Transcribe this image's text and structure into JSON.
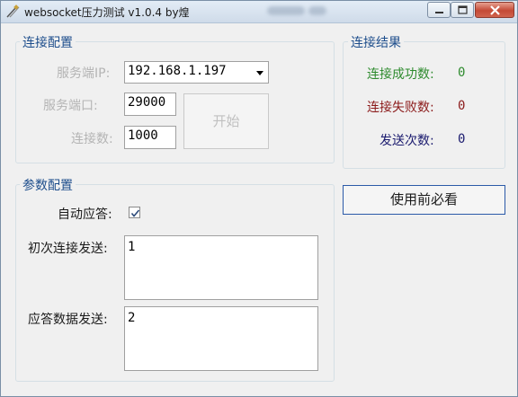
{
  "window": {
    "title": "websocket压力测试 v1.0.4 by煌"
  },
  "connection_config": {
    "title": "连接配置",
    "server_ip_label": "服务端IP:",
    "server_ip_value": "192.168.1.197",
    "server_port_label": "服务端口:",
    "server_port_value": "29000",
    "connection_count_label": "连接数:",
    "connection_count_value": "1000",
    "start_button_label": "开始"
  },
  "connection_result": {
    "title": "连接结果",
    "success_label": "连接成功数:",
    "success_value": "0",
    "success_color": "#2e8b2e",
    "failure_label": "连接失败数:",
    "failure_value": "0",
    "failure_color": "#8b1a1a",
    "sent_label": "发送次数:",
    "sent_value": "0",
    "sent_color": "#1a1a6e"
  },
  "guide_button_label": "使用前必看",
  "param_config": {
    "title": "参数配置",
    "auto_reply_label": "自动应答:",
    "auto_reply_checked": true,
    "first_send_label": "初次连接发送:",
    "first_send_value": "1",
    "reply_send_label": "应答数据发送:",
    "reply_send_value": "2"
  }
}
